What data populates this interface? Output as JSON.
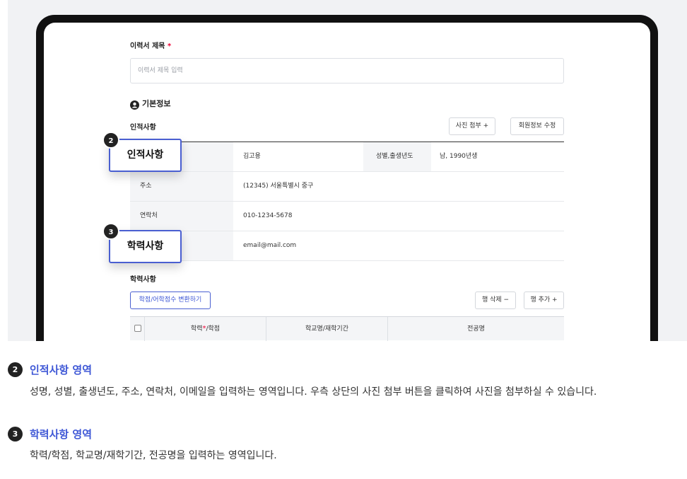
{
  "form": {
    "resume_title_label": "이력서 제목",
    "required_mark": "*",
    "resume_title_placeholder": "이력서 제목 입력",
    "basic_info_heading": "기본정보",
    "personal_heading": "인적사항",
    "photo_attach_button": "사진 첨부 +",
    "edit_member_button": "회원정보 수정",
    "personal_rows": [
      {
        "key": "",
        "value": "김고용",
        "key2": "성별,출생년도",
        "value2": "남, 1990년생"
      },
      {
        "key": "주소",
        "value": "(12345) 서울특별시 중구"
      },
      {
        "key": "연락처",
        "value": "010-1234-5678"
      },
      {
        "key": "",
        "value": "email@mail.com"
      }
    ],
    "education_heading": "학력사항",
    "convert_button": "학점/어학점수 변환하기",
    "delete_row_button": "행 삭제 −",
    "add_row_button": "행 추가 +",
    "table_headers": [
      "학력",
      "/학점",
      "학교명/재학기간",
      "전공명"
    ]
  },
  "callouts": [
    {
      "number": "2",
      "label": "인적사항"
    },
    {
      "number": "3",
      "label": "학력사항"
    }
  ],
  "sections": [
    {
      "number": "2",
      "title": "인적사항 영역",
      "description": "성명, 성별, 출생년도, 주소, 연락처, 이메일을 입력하는 영역입니다. 우측 상단의 사진 첨부 버튼을 클릭하여 사진을 첨부하실 수 있습니다."
    },
    {
      "number": "3",
      "title": "학력사항 영역",
      "description": "학력/학점, 학교명/재학기간, 전공명을 입력하는 영역입니다."
    }
  ],
  "colors": {
    "accent": "#3f58d6",
    "required": "#ee0033"
  }
}
